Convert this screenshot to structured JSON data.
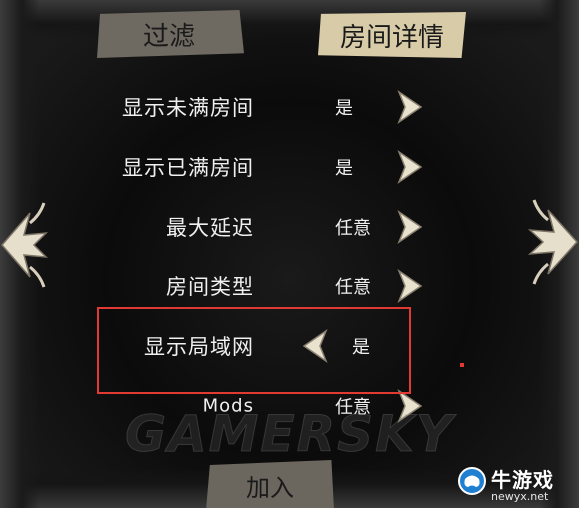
{
  "tabs": {
    "filter": "过滤",
    "room_details": "房间详情"
  },
  "rows": [
    {
      "label": "显示未满房间",
      "value": "是"
    },
    {
      "label": "显示已满房间",
      "value": "是"
    },
    {
      "label": "最大延迟",
      "value": "任意"
    },
    {
      "label": "房间类型",
      "value": "任意"
    },
    {
      "label": "显示局域网",
      "value": "是"
    },
    {
      "label": "Mods",
      "value": "任意"
    }
  ],
  "join_button": "加入",
  "watermark": "GAMERSKY",
  "logo": {
    "name": "牛游戏",
    "url": "newyx.net"
  },
  "colors": {
    "highlight": "#e03a32",
    "active_tab": "#d8cba8",
    "inactive_tab": "#6f6a61"
  },
  "icons": {
    "next": "arrow-right-icon",
    "prev": "arrow-left-icon",
    "page_prev": "ornate-left-arrow-icon",
    "page_next": "ornate-right-arrow-icon"
  }
}
